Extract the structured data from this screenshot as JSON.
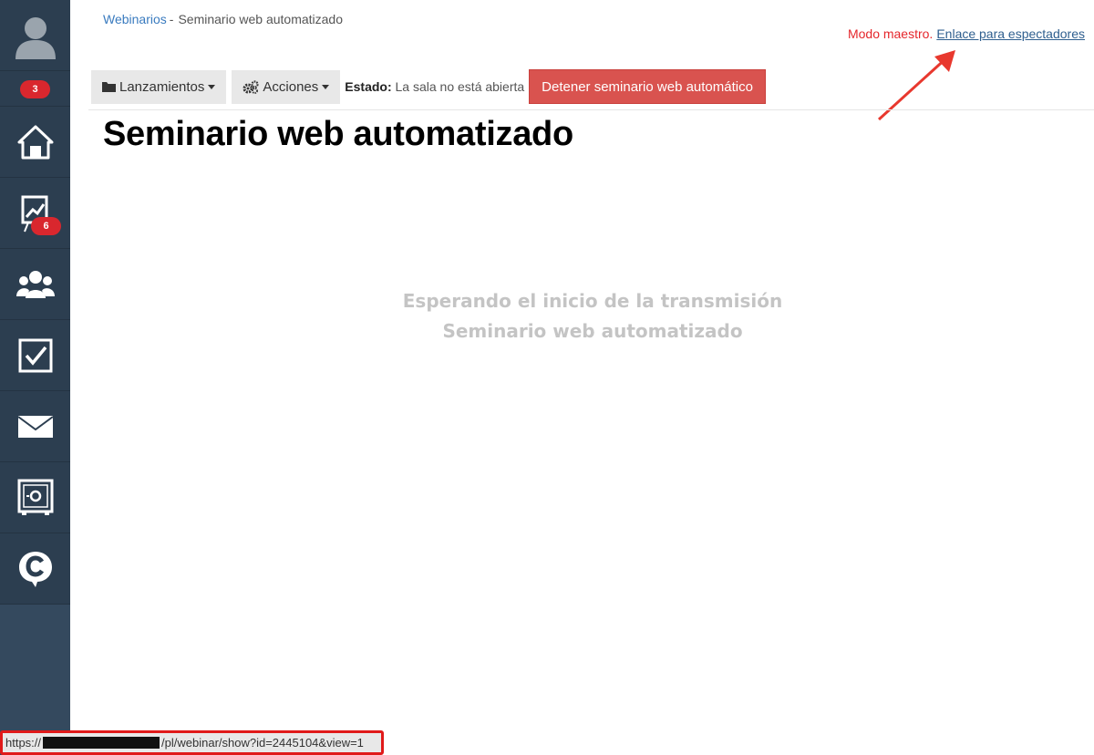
{
  "sidebar": {
    "badge_top": "3",
    "badge_chart": "6",
    "items": [
      {
        "name": "avatar",
        "icon": "user-silhouette-icon"
      },
      {
        "name": "home",
        "icon": "home-icon"
      },
      {
        "name": "chart",
        "icon": "presentation-chart-icon"
      },
      {
        "name": "users",
        "icon": "users-group-icon"
      },
      {
        "name": "tasks",
        "icon": "checkbox-icon"
      },
      {
        "name": "mail",
        "icon": "envelope-icon"
      },
      {
        "name": "safe",
        "icon": "safe-icon"
      },
      {
        "name": "chat",
        "icon": "chat-c-icon"
      }
    ],
    "colors": {
      "bg": "#2c3e50",
      "badge": "#d9272e"
    }
  },
  "breadcrumb": {
    "parent": "Webinarios",
    "separator": "-",
    "current": "Seminario web automatizado"
  },
  "master_mode": {
    "label": "Modo maestro.",
    "link": "Enlace para espectadores"
  },
  "toolbar": {
    "launches_label": "Lanzamientos",
    "actions_label": "Acciones",
    "status_label": "Estado:",
    "status_value": "La sala no está abierta",
    "stop_label": "Detener seminario web automático"
  },
  "page": {
    "title": "Seminario web automatizado",
    "waiting_line1": "Esperando el inicio de la transmisión",
    "waiting_line2": "Seminario web automatizado"
  },
  "status_url": {
    "prefix": "https://",
    "suffix": "/pl/webinar/show?id=2445104&view=1"
  }
}
